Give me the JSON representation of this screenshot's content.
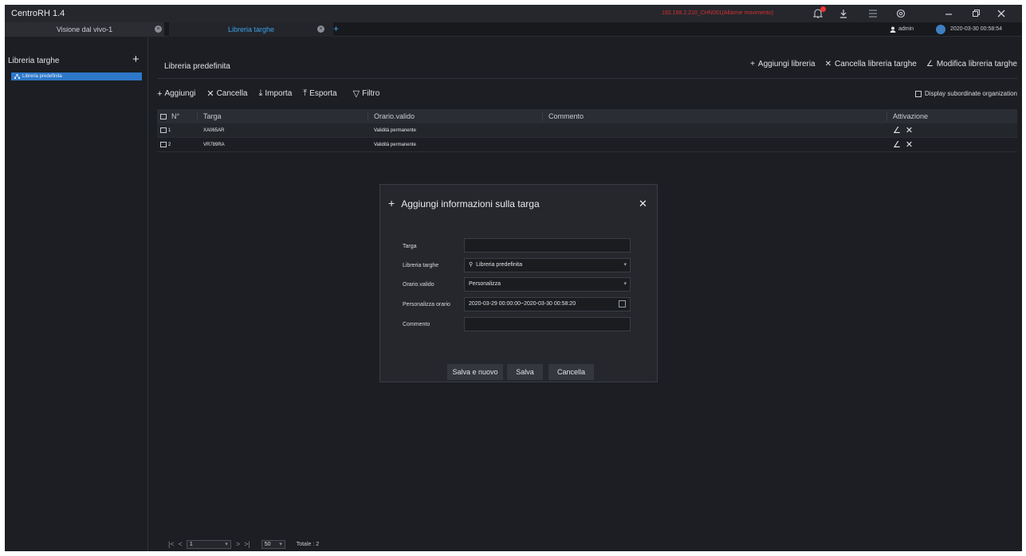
{
  "app": {
    "title": "CentroRH 1.4",
    "alarm_text": "192.168.2.210_CHN001(Allarme movimento)"
  },
  "tabs": [
    {
      "label": "Visione dal vivo-1",
      "active": false
    },
    {
      "label": "Libreria targhe",
      "active": true
    }
  ],
  "user": {
    "name": "admin",
    "datetime": "2020-03-30 00:58:54"
  },
  "sidebar": {
    "title": "Libreria targhe",
    "items": [
      {
        "label": "Libreria predefinita",
        "selected": true
      }
    ]
  },
  "main": {
    "title": "Libreria predefinita",
    "actions": {
      "add_library": "Aggiungi libreria",
      "delete_library": "Cancella libreria targhe",
      "edit_library": "Modifica libreria targhe"
    },
    "toolbar": {
      "add": "Aggiungi",
      "delete": "Cancella",
      "import": "Importa",
      "export": "Esporta",
      "filter": "Filtro"
    },
    "display_subordinate": "Display subordinate organization",
    "table": {
      "headers": {
        "num": "N°",
        "plate": "Targa",
        "time": "Orario.valido",
        "comment": "Commento",
        "action": "Attivazione"
      },
      "rows": [
        {
          "num": "1",
          "plate": "XA065AR",
          "time": "Validità permanente",
          "comment": ""
        },
        {
          "num": "2",
          "plate": "VR789RA",
          "time": "Validità permanente",
          "comment": ""
        }
      ]
    },
    "pager": {
      "page": "1",
      "page_size": "50",
      "total": "Totale : 2"
    }
  },
  "modal": {
    "title": "Aggiungi informazioni sulla targa",
    "fields": {
      "plate_label": "Targa",
      "plate_value": "",
      "library_label": "Libreria targhe",
      "library_value": "Libreria predefinita",
      "time_label": "Orario.valido",
      "time_value": "Personalizza",
      "custom_label": "Personalizza orario",
      "custom_value": "2020-03-29 00:00:00~2020-03-30 00:58:20",
      "comment_label": "Commento",
      "comment_value": ""
    },
    "buttons": {
      "save_new": "Salva e nuovo",
      "save": "Salva",
      "cancel": "Cancella"
    }
  },
  "colors": {
    "accent": "#2d78c9",
    "tab_active_text": "#3aa0e8",
    "alarm": "#d62f2f"
  }
}
